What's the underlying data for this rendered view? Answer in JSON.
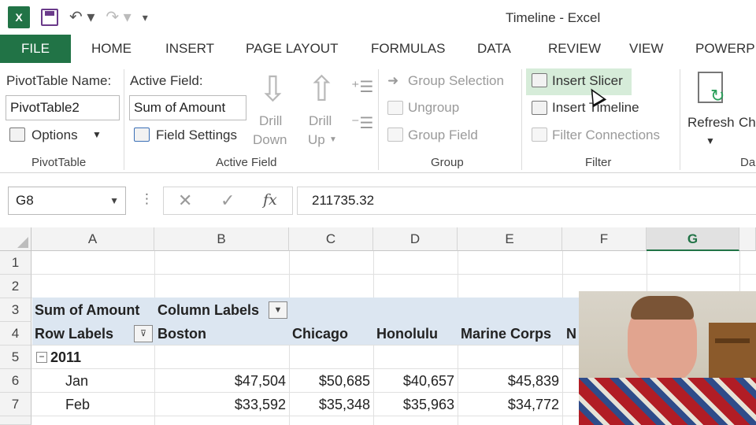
{
  "window": {
    "title": "Timeline - Excel",
    "app_logo": "X"
  },
  "qat": {
    "icons": [
      "excel-icon",
      "save-icon",
      "undo-icon",
      "redo-icon",
      "customize-icon"
    ]
  },
  "tabs": [
    "FILE",
    "HOME",
    "INSERT",
    "PAGE LAYOUT",
    "FORMULAS",
    "DATA",
    "REVIEW",
    "VIEW",
    "POWERPI"
  ],
  "ribbon": {
    "pivottable": {
      "name_label": "PivotTable Name:",
      "name_value": "PivotTable2",
      "options_label": "Options",
      "group_label": "PivotTable"
    },
    "active_field": {
      "label": "Active Field:",
      "value": "Sum of Amount",
      "field_settings": "Field Settings",
      "drill_down_1": "Drill",
      "drill_down_2": "Down",
      "drill_up_1": "Drill",
      "drill_up_2": "Up",
      "group_label": "Active Field"
    },
    "group": {
      "group_selection": "Group Selection",
      "ungroup": "Ungroup",
      "group_field": "Group Field",
      "group_label": "Group"
    },
    "filter": {
      "insert_slicer": "Insert Slicer",
      "insert_timeline": "Insert Timeline",
      "filter_connections": "Filter Connections",
      "group_label": "Filter"
    },
    "data": {
      "refresh": "Refresh",
      "change": "Ch",
      "group_label": "Da"
    }
  },
  "formula_bar": {
    "name_box": "G8",
    "cancel": "✕",
    "enter": "✓",
    "fx": "fx",
    "value": "211735.32"
  },
  "grid": {
    "columns": [
      "A",
      "B",
      "C",
      "D",
      "E",
      "F",
      "G"
    ],
    "rows": [
      "1",
      "2",
      "3",
      "4",
      "5",
      "6",
      "7"
    ],
    "selected_column": "G",
    "pivot": {
      "sum_label": "Sum of Amount",
      "column_labels": "Column Labels",
      "row_labels": "Row Labels",
      "headers": [
        "Boston",
        "Chicago",
        "Honolulu",
        "Marine Corps",
        "N"
      ],
      "year": "2011",
      "rows": [
        {
          "label": "Jan",
          "values": [
            "$47,504",
            "$50,685",
            "$40,657",
            "$45,839"
          ]
        },
        {
          "label": "Feb",
          "values": [
            "$33,592",
            "$35,348",
            "$35,963",
            "$34,772"
          ]
        }
      ]
    }
  }
}
